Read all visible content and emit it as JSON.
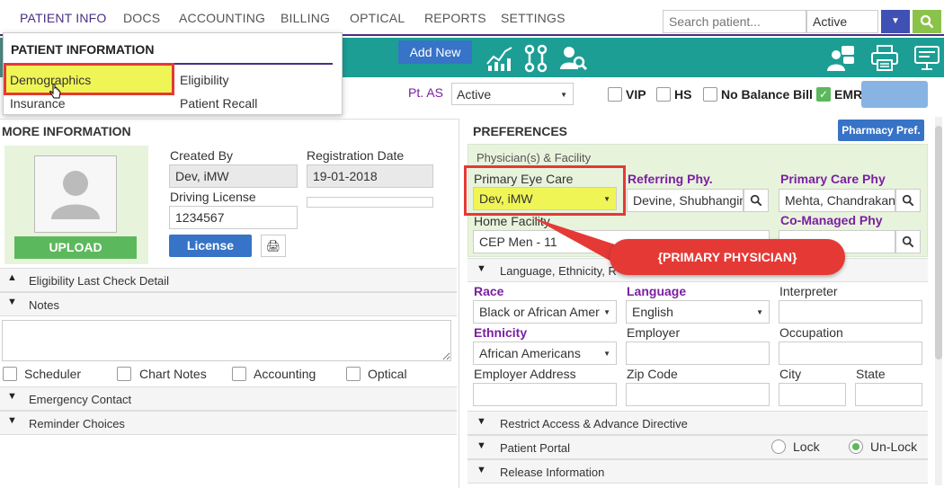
{
  "nav": {
    "items": [
      "PATIENT INFO",
      "DOCS",
      "ACCOUNTING",
      "BILLING",
      "OPTICAL",
      "REPORTS",
      "SETTINGS"
    ],
    "search_placeholder": "Search patient...",
    "status_value": "Active"
  },
  "toolbar": {
    "add_new": "Add New"
  },
  "menu": {
    "title": "PATIENT INFORMATION",
    "items": [
      "Demographics",
      "Eligibility",
      "Insurance",
      "Patient Recall"
    ]
  },
  "row2": {
    "ptas_label": "Pt. AS",
    "ptas_value": "Active",
    "vip": "VIP",
    "hs": "HS",
    "no_balance": "No Balance Bill",
    "emr": "EMR"
  },
  "left": {
    "header": "MORE INFORMATION",
    "created_by_label": "Created By",
    "created_by": "Dev, iMW",
    "reg_date_label": "Registration Date",
    "reg_date": "19-01-2018",
    "driving_license_label": "Driving License",
    "driving_license": "1234567",
    "upload": "UPLOAD",
    "license_btn": "License",
    "bars": {
      "eligibility": "Eligibility Last Check Detail",
      "notes": "Notes",
      "emergency": "Emergency Contact",
      "reminder": "Reminder Choices"
    },
    "note_checks": [
      "Scheduler",
      "Chart Notes",
      "Accounting",
      "Optical"
    ]
  },
  "right": {
    "header": "PREFERENCES",
    "pharmacy_btn": "Pharmacy Pref.",
    "physician_header": "Physician(s) & Facility",
    "primary_eye_care_label": "Primary Eye Care",
    "primary_eye_care": "Dev, iMW",
    "referring_label": "Referring Phy.",
    "referring": "Devine, Shubhangin",
    "primary_care_label": "Primary Care Phy",
    "primary_care": "Mehta, Chandrakan",
    "home_facility_label": "Home Facility",
    "home_facility": "CEP Men - 11",
    "co_managed_label": "Co-Managed Phy",
    "callout": "{PRIMARY PHYSICIAN}",
    "language_bar": "Language, Ethnicity, R",
    "race_label": "Race",
    "race": "Black or African Amer",
    "language_label": "Language",
    "language": "English",
    "interpreter_label": "Interpreter",
    "ethnicity_label": "Ethnicity",
    "ethnicity": "African Americans",
    "employer_label": "Employer",
    "occupation_label": "Occupation",
    "employer_address_label": "Employer Address",
    "zip_label": "Zip Code",
    "city_label": "City",
    "state_label": "State",
    "restrict_bar": "Restrict Access & Advance Directive",
    "portal_bar": "Patient Portal",
    "lock": "Lock",
    "unlock": "Un-Lock",
    "release_bar": "Release Information"
  }
}
